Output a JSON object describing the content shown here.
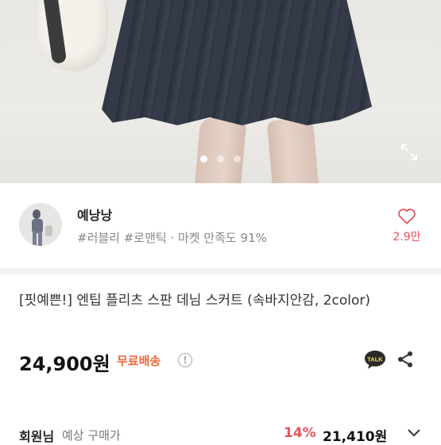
{
  "gallery": {
    "slide_count": 3,
    "active_index": 0
  },
  "seller": {
    "name": "예낭낭",
    "tags": "#러블리 #로맨틱 · 마켓 만족도 91%",
    "likes": "2.9만"
  },
  "product": {
    "title": "[핏예쁜!] 엔팁 플리츠 스판 데님 스커트 (속바지안감, 2color)",
    "price": "24,900원",
    "shipping": "무료배송",
    "talk_label": "TALK"
  },
  "member": {
    "label": "회원님",
    "sub": "예상 구매가",
    "discount": "14%",
    "price": "21,410원"
  },
  "colors": {
    "accent_red": "#e8525f",
    "shipping_orange": "#f0653a"
  }
}
